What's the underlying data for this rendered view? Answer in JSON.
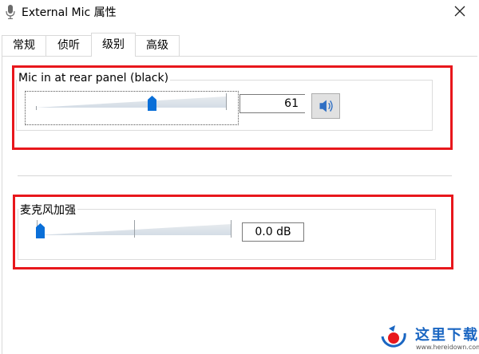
{
  "window": {
    "title": "External Mic 属性"
  },
  "tabs": [
    {
      "label": "常规",
      "active": false
    },
    {
      "label": "侦听",
      "active": false
    },
    {
      "label": "级别",
      "active": true
    },
    {
      "label": "高级",
      "active": false
    }
  ],
  "levels": {
    "mic": {
      "label": "Mic in at rear panel (black)",
      "value": "61",
      "position": 0.61
    },
    "boost": {
      "label": "麦克风加强",
      "value": "0.0 dB",
      "position": 0.0
    }
  },
  "watermark": {
    "brand": "这里下载",
    "url": "www.hereidown.com"
  },
  "colors": {
    "highlight": "#e8171c",
    "thumb": "#0a6fd8",
    "watermark": "#1a66c2"
  }
}
